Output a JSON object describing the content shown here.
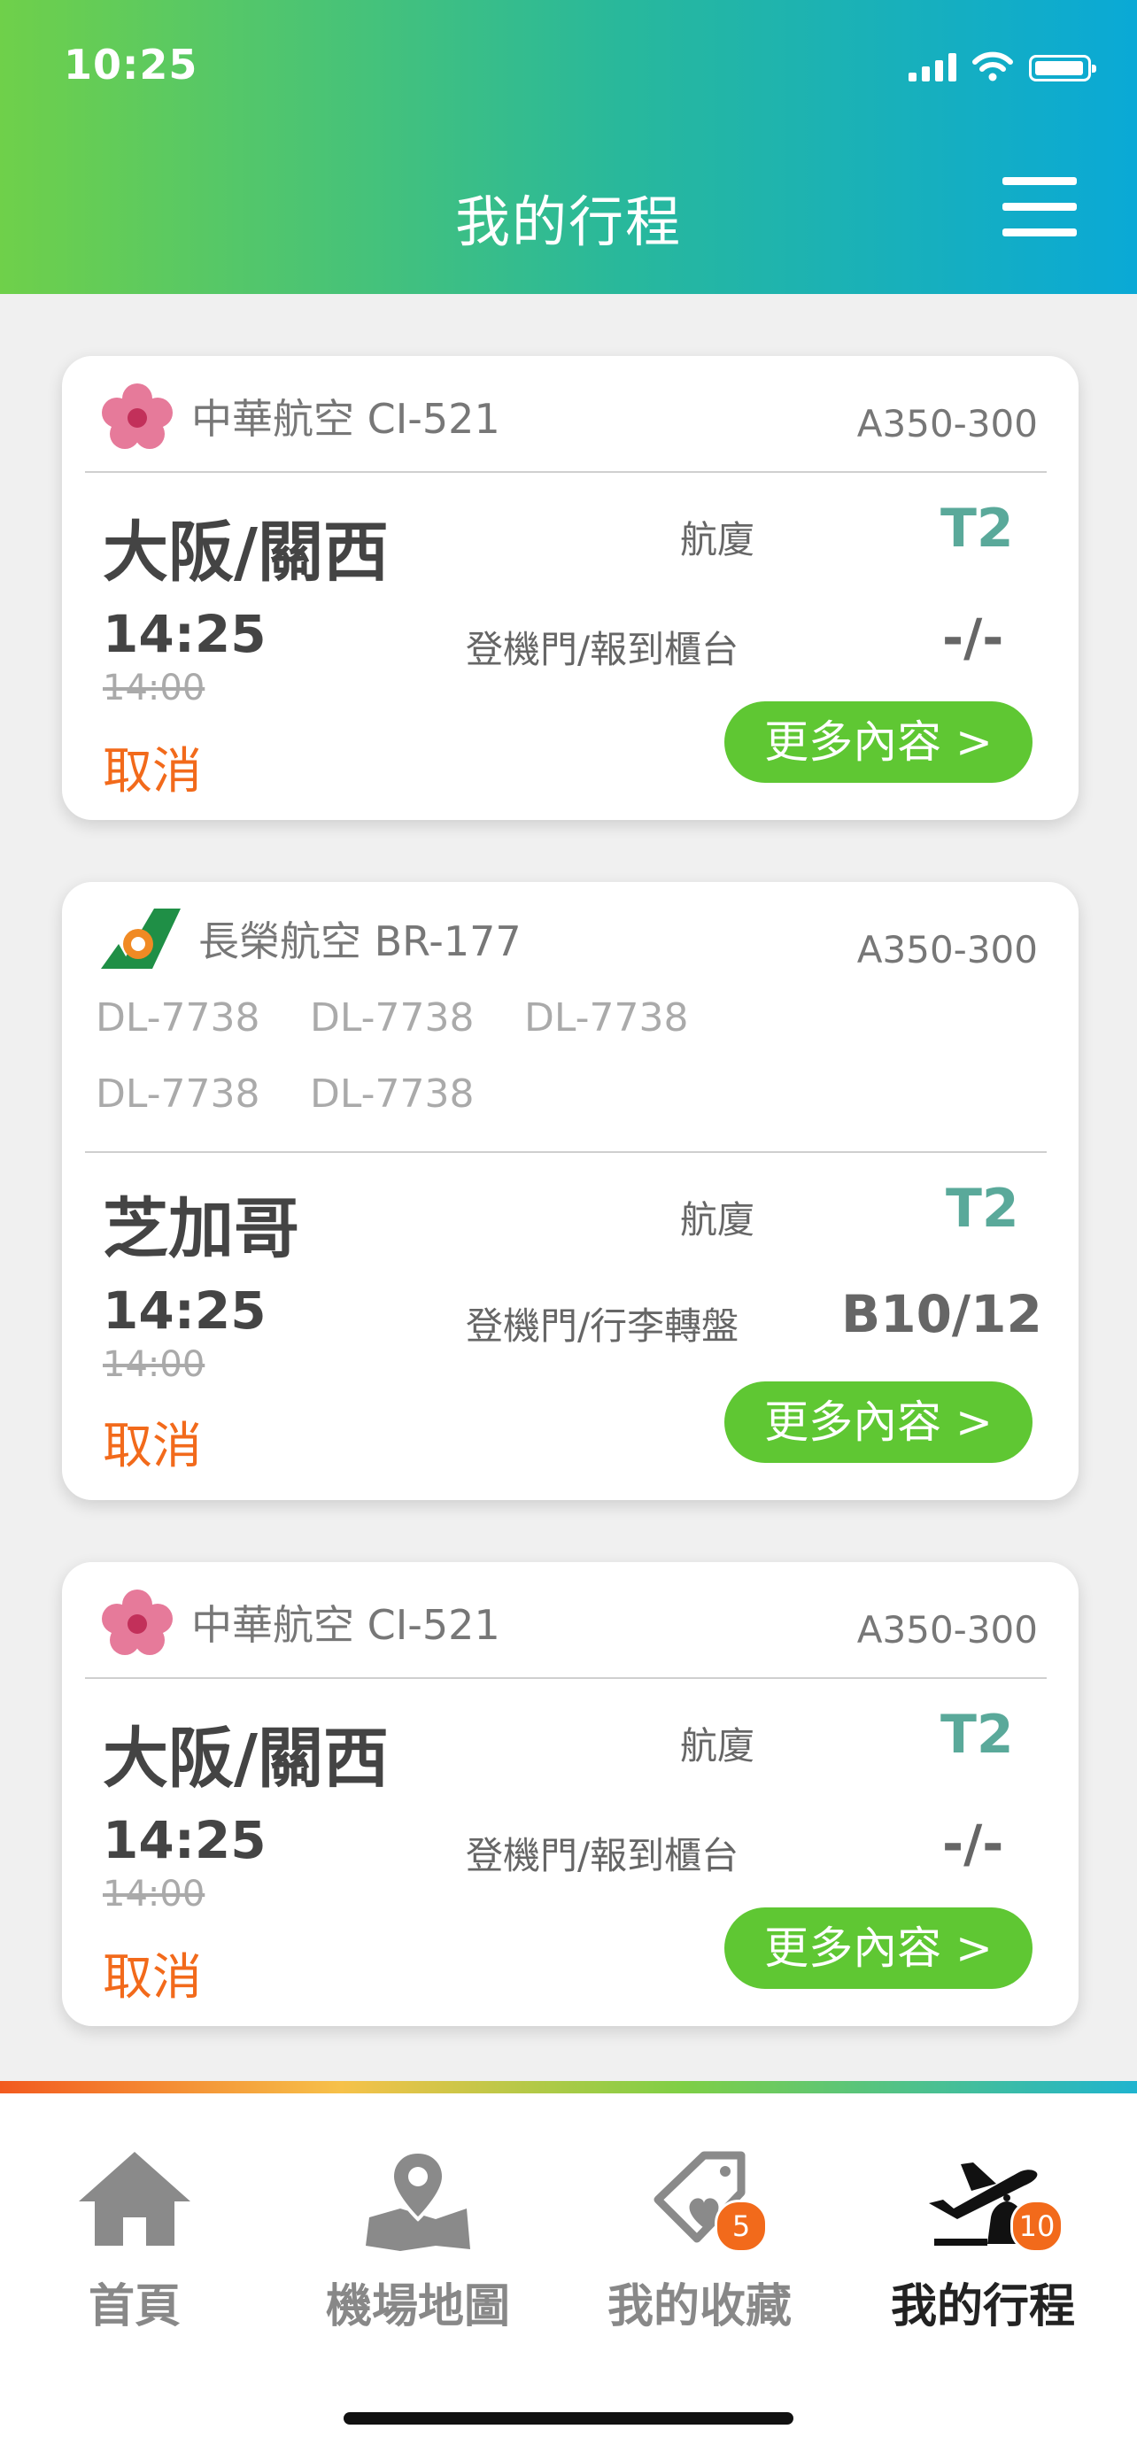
{
  "status_bar": {
    "time": "10:25"
  },
  "header": {
    "title": "我的行程"
  },
  "flights": [
    {
      "airline": "中華航空 CI-521",
      "aircraft": "A350-300",
      "codeshares": [],
      "destination": "大阪/關西",
      "terminal_label": "航廈",
      "terminal": "T2",
      "time": "14:25",
      "original_time": "14:00",
      "gate_label": "登機門/報到櫃台",
      "gate": "-/-",
      "status": "取消",
      "more_label": "更多內容 >"
    },
    {
      "airline": "長榮航空 BR-177",
      "aircraft": "A350-300",
      "codeshares": [
        "DL-7738",
        "DL-7738",
        "DL-7738",
        "DL-7738",
        "DL-7738"
      ],
      "destination": "芝加哥",
      "terminal_label": "航廈",
      "terminal": "T2",
      "time": "14:25",
      "original_time": "14:00",
      "gate_label": "登機門/行李轉盤",
      "gate": "B10/12",
      "status": "取消",
      "more_label": "更多內容 >"
    },
    {
      "airline": "中華航空 CI-521",
      "aircraft": "A350-300",
      "codeshares": [],
      "destination": "大阪/關西",
      "terminal_label": "航廈",
      "terminal": "T2",
      "time": "14:25",
      "original_time": "14:00",
      "gate_label": "登機門/報到櫃台",
      "gate": "-/-",
      "status": "取消",
      "more_label": "更多內容 >"
    }
  ],
  "tabbar": {
    "items": [
      {
        "label": "首頁",
        "icon": "home-icon"
      },
      {
        "label": "機場地圖",
        "icon": "map-icon"
      },
      {
        "label": "我的收藏",
        "icon": "favorites-tag-icon",
        "badge": "5"
      },
      {
        "label": "我的行程",
        "icon": "flight-bell-icon",
        "badge": "10",
        "active": true
      }
    ]
  },
  "colors": {
    "header_gradient": [
      "#6fd04a",
      "#0aa9d6"
    ],
    "accent_green": "#5fc733",
    "status_orange": "#f26a1b",
    "terminal_teal": "#5aa99a"
  }
}
